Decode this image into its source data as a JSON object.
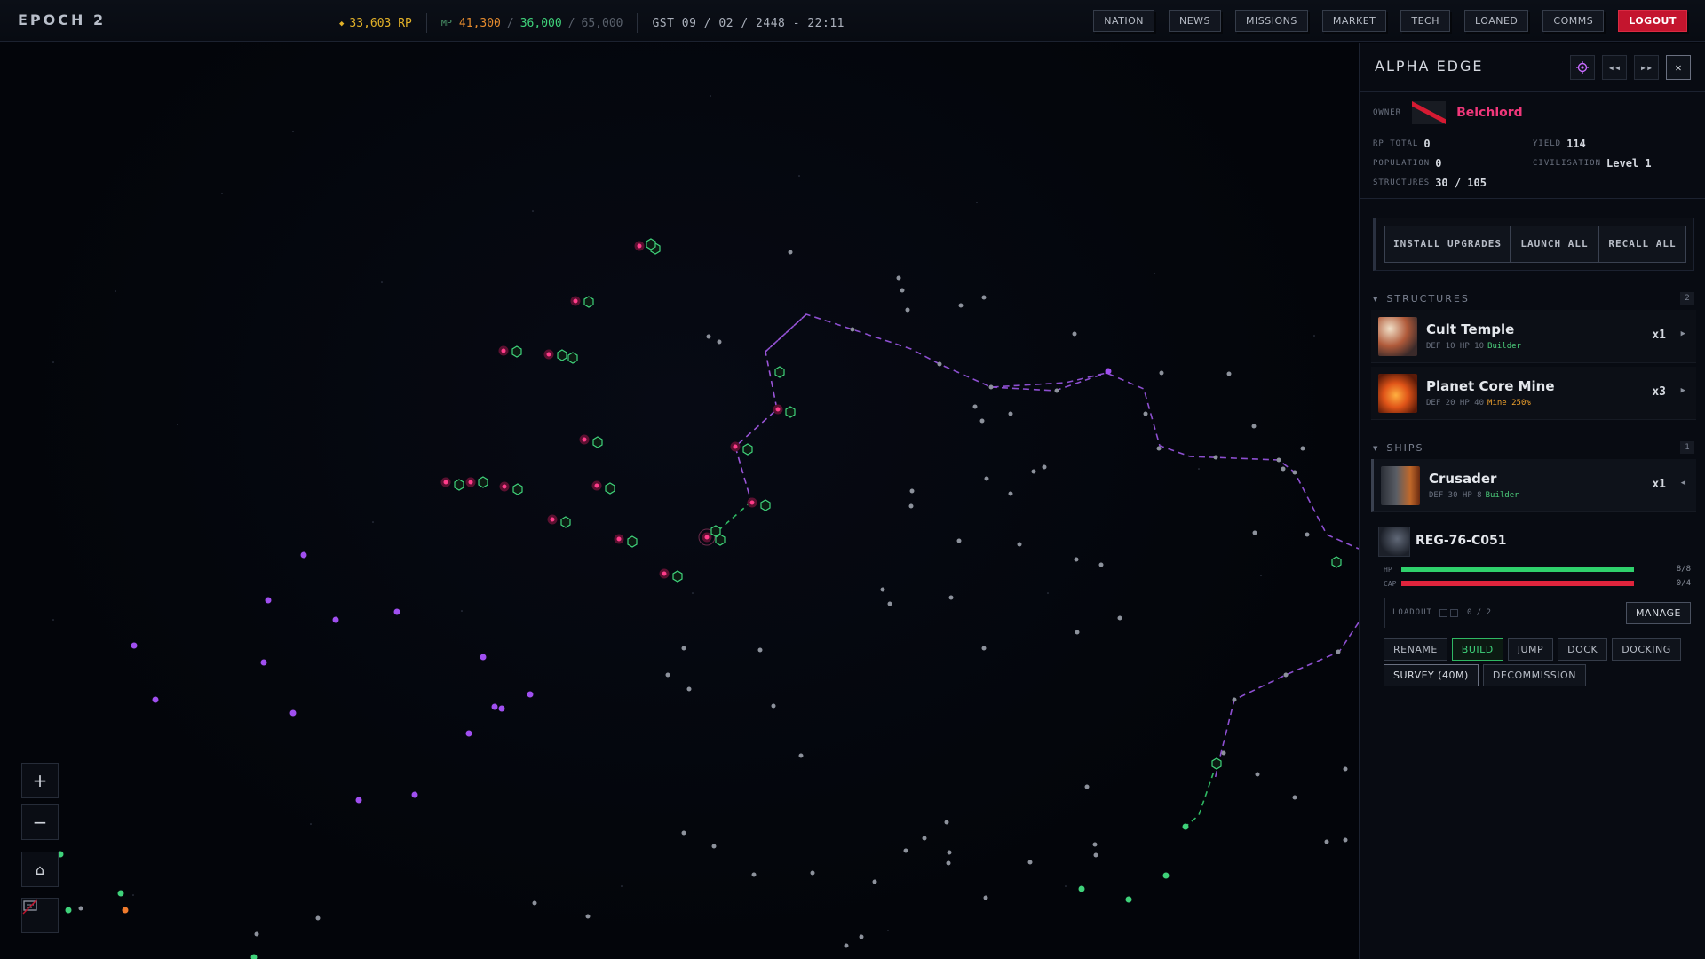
{
  "topbar": {
    "brand": "EPOCH 2",
    "rp": "33,603 RP",
    "mp_label": "MP",
    "mp_current": "41,300",
    "mp_second": "36,000",
    "mp_max": "65,000",
    "gst": "GST 09 / 02 / 2448 - 22:11",
    "nav": [
      "NATION",
      "NEWS",
      "MISSIONS",
      "MARKET",
      "TECH",
      "LOANED",
      "COMMS",
      "LOGOUT"
    ]
  },
  "map_controls": {
    "zoom_in": "+",
    "zoom_out": "−"
  },
  "panel": {
    "title": "ALPHA EDGE",
    "owner_label": "OWNER",
    "owner_name": "Belchlord",
    "rp_total_label": "RP TOTAL",
    "rp_total": "0",
    "yield_label": "YIELD",
    "yield": "114",
    "population_label": "POPULATION",
    "population": "0",
    "civilisation_label": "CIVILISATION",
    "civilisation": "Level 1",
    "structures_label": "STRUCTURES",
    "structures": "30 / 105",
    "actions": {
      "install": "INSTALL UPGRADES",
      "launch": "LAUNCH ALL",
      "recall": "RECALL ALL"
    },
    "structures_section": {
      "title": "STRUCTURES",
      "count": "2",
      "items": [
        {
          "name": "Cult Temple",
          "stats": "DEF 10  HP 10",
          "role": "Builder",
          "qty": "x1"
        },
        {
          "name": "Planet Core Mine",
          "stats": "DEF 20  HP 40",
          "role": "Mine 250%",
          "qty": "x3"
        }
      ]
    },
    "ships_section": {
      "title": "SHIPS",
      "count": "1",
      "items": [
        {
          "name": "Crusader",
          "stats": "DEF 30  HP 8",
          "role": "Builder",
          "qty": "x1"
        }
      ]
    },
    "ship_detail": {
      "name": "REG-76-C051",
      "hp_label": "HP",
      "hp_value": "8/8",
      "hp_fraction": 1.0,
      "cap_label": "CAP",
      "cap_value": "0/4",
      "cap_fraction": 1.0,
      "loadout_label": "LOADOUT",
      "loadout_count": "0 / 2",
      "manage": "MANAGE",
      "buttons_row1": [
        "RENAME",
        "BUILD",
        "JUMP",
        "DOCK",
        "DOCKING"
      ],
      "buttons_row2": [
        "SURVEY (40M)",
        "DECOMMISSION"
      ]
    }
  },
  "colors": {
    "accent_red": "#c4152e",
    "owner_pink": "#f0377a",
    "hp_green": "#2fd16c",
    "cap_red": "#e0243c",
    "route_purple": "#9a55d8",
    "route_green": "#3fd27a",
    "star_gray": "#8d929c",
    "owned_pink": "#ff3d8b"
  }
}
